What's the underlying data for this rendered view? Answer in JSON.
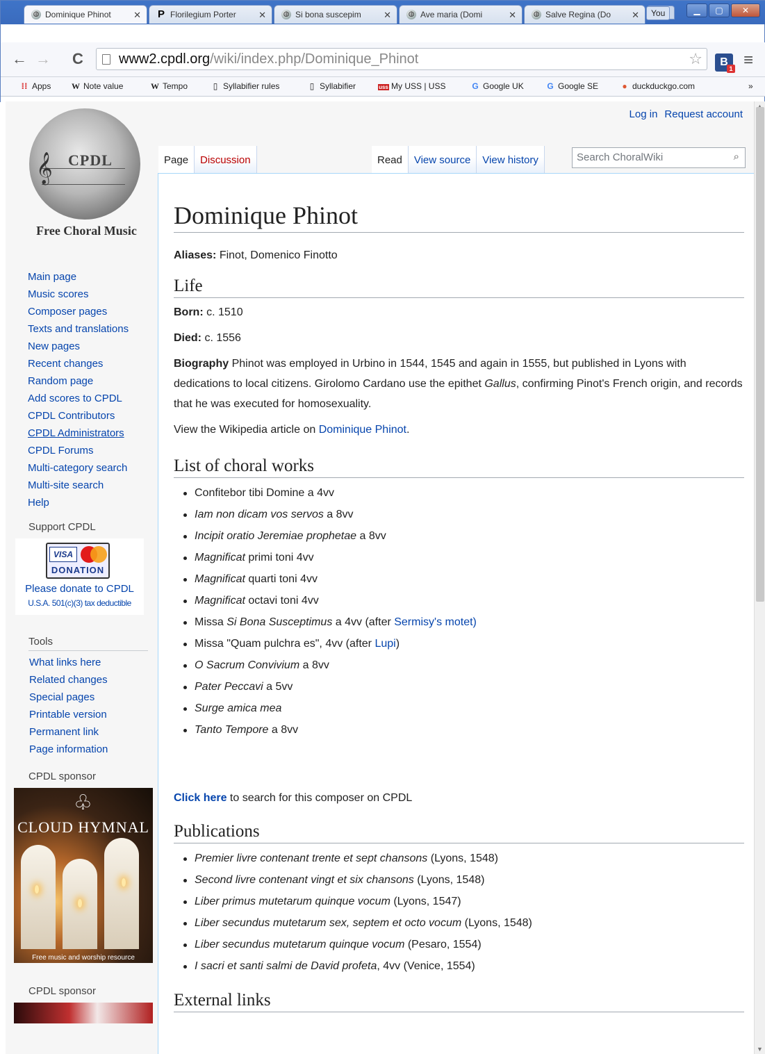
{
  "browser": {
    "tabs": [
      {
        "title": "Dominique Phinot",
        "icon": "cpdl-globe-icon",
        "active": true
      },
      {
        "title": "Florilegium Porter",
        "icon": "p-logo-icon",
        "active": false
      },
      {
        "title": "Si bona suscepim",
        "icon": "cpdl-globe-icon",
        "active": false
      },
      {
        "title": "Ave maria (Domi",
        "icon": "cpdl-globe-icon",
        "active": false
      },
      {
        "title": "Salve Regina (Do",
        "icon": "cpdl-globe-icon",
        "active": false
      }
    ],
    "profile_label": "You",
    "url_host": "www2.cpdl.org",
    "url_path": "/wiki/index.php/Dominique_Phinot",
    "bookmarks": [
      {
        "label": "Apps",
        "icon": "apps-grid-icon"
      },
      {
        "label": "Note value",
        "icon": "wikipedia-w-icon"
      },
      {
        "label": "Tempo",
        "icon": "wikipedia-w-icon"
      },
      {
        "label": "Syllabifier rules",
        "icon": "page-icon"
      },
      {
        "label": "Syllabifier",
        "icon": "page-icon"
      },
      {
        "label": "My USS | USS",
        "icon": "uss-icon"
      },
      {
        "label": "Google UK",
        "icon": "google-g-icon"
      },
      {
        "label": "Google SE",
        "icon": "google-g-icon"
      },
      {
        "label": "duckduckgo.com",
        "icon": "duckduckgo-icon"
      }
    ],
    "bookmarks_overflow": "»"
  },
  "personal": {
    "login": "Log in",
    "request": "Request account"
  },
  "logo": {
    "caption": "Free Choral Music",
    "mark": "CPDL"
  },
  "nav": [
    "Main page",
    "Music scores",
    "Composer pages",
    "Texts and translations",
    "New pages",
    "Recent changes",
    "Random page",
    "Add scores to CPDL",
    "CPDL Contributors",
    "CPDL Administrators",
    "CPDL Forums",
    "Multi-category search",
    "Multi-site search",
    "Help"
  ],
  "support": {
    "heading": "Support CPDL",
    "donation_label": "DONATION",
    "visa": "VISA",
    "line1": "Please donate to CPDL",
    "line2": "U.S.A. 501(c)(3) tax deductible"
  },
  "tools": {
    "heading": "Tools",
    "items": [
      "What links here",
      "Related changes",
      "Special pages",
      "Printable version",
      "Permanent link",
      "Page information"
    ]
  },
  "sponsor": {
    "heading": "CPDL sponsor",
    "title": "CLOUD HYMNAL",
    "footer": "Free music and worship resource",
    "heading2": "CPDL sponsor"
  },
  "page_tabs": {
    "page": "Page",
    "discussion": "Discussion",
    "read": "Read",
    "view_source": "View source",
    "view_history": "View history"
  },
  "search": {
    "placeholder": "Search ChoralWiki"
  },
  "article": {
    "title": "Dominique Phinot",
    "aliases_label": "Aliases:",
    "aliases": " Finot, Domenico Finotto",
    "life_heading": "Life",
    "born_label": "Born:",
    "born": " c. 1510",
    "died_label": "Died:",
    "died": " c. 1556",
    "bio_label": "Biography",
    "bio_1": " Phinot was employed in Urbino in 1544, 1545 and again in 1555, but published in Lyons with dedications to local citizens. Girolomo Cardano use the epithet ",
    "bio_em": "Gallus",
    "bio_2": ", confirming Pinot's French origin, and records that he was executed for homosexuality.",
    "wiki_pre": "View the Wikipedia article on ",
    "wiki_link": "Dominique Phinot",
    "wiki_post": ".",
    "works_heading": "List of choral works",
    "works": [
      {
        "plain_pre": "Confitebor tibi Domine a 4vv",
        "em": "",
        "plain": "",
        "link": "",
        "tail": ""
      },
      {
        "plain_pre": "",
        "em": "Iam non dicam vos servos",
        "plain": " a 8vv",
        "link": "",
        "tail": ""
      },
      {
        "plain_pre": "",
        "em": "Incipit oratio Jeremiae prophetae",
        "plain": " a 8vv",
        "link": "",
        "tail": ""
      },
      {
        "plain_pre": "",
        "em": "Magnificat",
        "plain": " primi toni 4vv",
        "link": "",
        "tail": ""
      },
      {
        "plain_pre": "",
        "em": "Magnificat",
        "plain": " quarti toni 4vv",
        "link": "",
        "tail": ""
      },
      {
        "plain_pre": "",
        "em": "Magnificat",
        "plain": " octavi toni 4vv",
        "link": "",
        "tail": ""
      },
      {
        "plain_pre": "Missa ",
        "em": "Si Bona Susceptimus",
        "plain": " a 4vv (after ",
        "link": "Sermisy's motet)",
        "tail": ""
      },
      {
        "plain_pre": "Missa \"Quam pulchra es\", 4vv (after ",
        "em": "",
        "plain": "",
        "link": "Lupi",
        "tail": ")"
      },
      {
        "plain_pre": "",
        "em": "O Sacrum Convivium",
        "plain": " a 8vv",
        "link": "",
        "tail": ""
      },
      {
        "plain_pre": "",
        "em": "Pater Peccavi",
        "plain": " a 5vv",
        "link": "",
        "tail": ""
      },
      {
        "plain_pre": "",
        "em": "Surge amica mea",
        "plain": "",
        "link": "",
        "tail": ""
      },
      {
        "plain_pre": "",
        "em": "Tanto Tempore",
        "plain": " a 8vv",
        "link": "",
        "tail": ""
      }
    ],
    "click_here": "Click here",
    "click_rest": " to search for this composer on CPDL",
    "pubs_heading": "Publications",
    "pubs": [
      {
        "em": "Premier livre contenant trente et sept chansons",
        "plain": " (Lyons, 1548)"
      },
      {
        "em": "Second livre contenant vingt et six chansons",
        "plain": " (Lyons, 1548)"
      },
      {
        "em": "Liber primus mutetarum quinque vocum",
        "plain": " (Lyons, 1547)"
      },
      {
        "em": "Liber secundus mutetarum sex, septem et octo vocum",
        "plain": " (Lyons, 1548)"
      },
      {
        "em": "Liber secundus mutetarum quinque vocum",
        "plain": " (Pesaro, 1554)"
      },
      {
        "em": "I sacri et santi salmi de David profeta",
        "plain": ", 4vv (Venice, 1554)"
      }
    ],
    "links_heading": "External links"
  }
}
